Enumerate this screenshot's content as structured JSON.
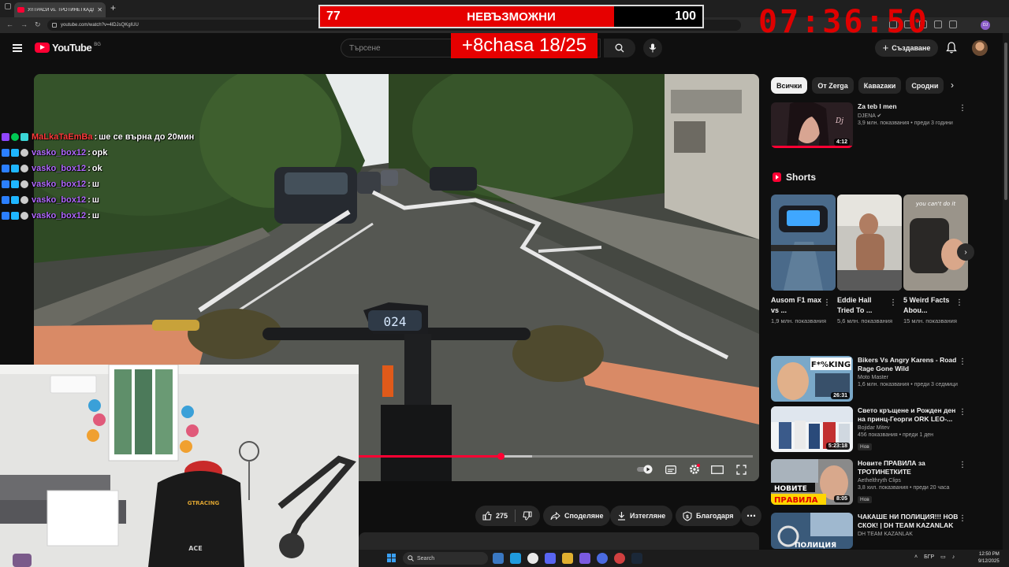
{
  "browser": {
    "tab_title": "УЛТРАСИ vs. ТРОТИНЕТКАДЖ",
    "tab_close": "✕",
    "new_tab": "+",
    "url": "youtube.com/watch?v=4lDJsQKgIUU"
  },
  "header": {
    "logo_text": "YouTube",
    "country": "BG",
    "search_placeholder": "Търсене",
    "create_label": "Създаване",
    "create_plus": "+"
  },
  "overlay": {
    "score_left": "77",
    "score_title": "НЕВЪЗМОЖНИ",
    "score_right": "100",
    "score_fill": 0.77,
    "bonus": "+8chasa 18/25",
    "timer": "07:36:50"
  },
  "chat": [
    {
      "user": "MaLkaTaEmBa",
      "sep": " : ",
      "message": "ше се върна до 20мин",
      "color": "#ff3b3b"
    },
    {
      "user": "vasko_box12",
      "sep": " : ",
      "message": "opk",
      "color": "#b169ff"
    },
    {
      "user": "vasko_box12",
      "sep": " : ",
      "message": "ok",
      "color": "#b169ff"
    },
    {
      "user": "vasko_box12",
      "sep": " : ",
      "message": "ш",
      "color": "#b169ff"
    },
    {
      "user": "vasko_box12",
      "sep": " : ",
      "message": "ш",
      "color": "#b169ff"
    },
    {
      "user": "vasko_box12",
      "sep": " : ",
      "message": "ш",
      "color": "#b169ff"
    }
  ],
  "player": {
    "played_fraction": 0.36,
    "buffered_fraction": 0.44,
    "speedometer": "024"
  },
  "actions": {
    "like_count": "275",
    "share": "Споделяне",
    "download": "Изтегляне",
    "thanks": "Благодаря",
    "more": "⋯"
  },
  "chips": [
    "Всички",
    "От Zerga",
    "Каваzаки",
    "Сродни"
  ],
  "recommendations": [
    {
      "title": "Za teb I men",
      "channel": "DJENA",
      "stats": "3,9 млн. показвания • преди 3 години",
      "duration": "4:12",
      "badge": ""
    },
    {
      "title": "Bikers Vs Angry Karens - Road Rage Gone Wild",
      "channel": "Moto Master",
      "stats": "1,6 млн. показвания • преди 3 седмици",
      "duration": "26:31",
      "badge": ""
    },
    {
      "title": "Свето кръщене и Рожден ден на принц-Георги ORK LEO-...",
      "channel": "Bojidar Mitev",
      "stats": "456 показвания • преди 1 ден",
      "duration": "5:23:18",
      "badge": "Нов"
    },
    {
      "title": "Новите ПРАВИЛА за ТРОТИНЕТКИТЕ",
      "channel": "Aethelthryth Clips",
      "stats": "3,8 хил. показвания • преди 20 часа",
      "duration": "8:05",
      "badge": "Нов"
    },
    {
      "title": "ЧАКАШЕ НИ ПОЛИЦИЯ!!! НОВ СКОК! | DH TEAM KAZANLAK",
      "channel": "DH TEAM KAZANLAK",
      "stats": "",
      "duration": "",
      "badge": ""
    }
  ],
  "shorts": {
    "heading": "Shorts",
    "items": [
      {
        "title": "Ausom F1 max vs ...",
        "views": "1,9 млн. показвания"
      },
      {
        "title": "Eddie Hall Tried To ...",
        "views": "5,6 млн. показвания"
      },
      {
        "title": "5 Weird Facts Abou...",
        "views": "15 млн. показвания"
      }
    ],
    "thumb_texts": [
      "",
      "",
      "you can't do it"
    ]
  },
  "thumb_texts": {
    "bikers": "F*%KING",
    "rules_top": "НОВИТЕ",
    "rules_bottom": "ПРАВИЛА",
    "police": "ПОЛИЦИЯ"
  },
  "webcam": {
    "chair_brand": "GTRACING",
    "chair_model": "ACE"
  },
  "taskbar": {
    "search": "Search",
    "lang": "БГР",
    "time": "12:50 PM",
    "date": "9/12/2025"
  }
}
